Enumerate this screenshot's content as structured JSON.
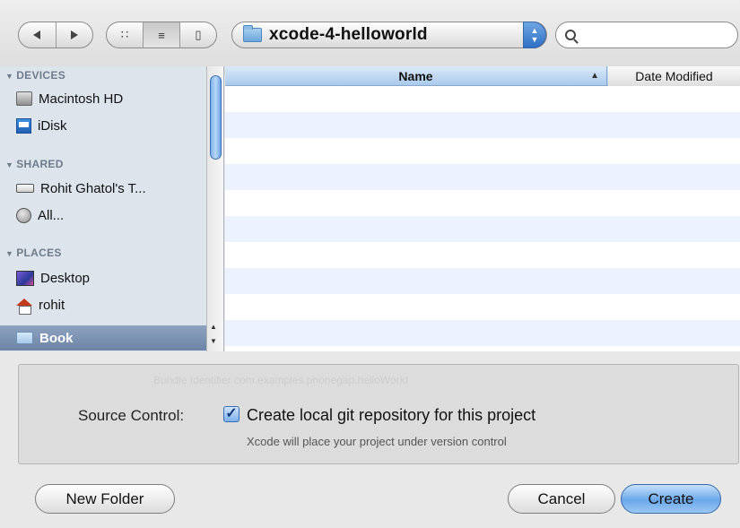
{
  "toolbar": {
    "nav": {
      "back_icon": "left-arrow-icon",
      "forward_icon": "right-arrow-icon"
    },
    "view_modes": [
      "icon-view-icon",
      "list-view-icon",
      "column-view-icon"
    ],
    "active_view": "list",
    "path_label": "xcode-4-helloworld",
    "search": {
      "value": "",
      "placeholder": ""
    }
  },
  "sidebar": {
    "devices_header": "DEVICES",
    "shared_header": "SHARED",
    "places_header": "PLACES",
    "devices": [
      {
        "label": "Macintosh HD",
        "icon": "hard-drive-icon"
      },
      {
        "label": "iDisk",
        "icon": "idisk-icon"
      }
    ],
    "shared": [
      {
        "label": "Rohit Ghatol's T...",
        "icon": "network-computer-icon"
      },
      {
        "label": "All...",
        "icon": "globe-icon"
      }
    ],
    "places": [
      {
        "label": "Desktop",
        "icon": "desktop-icon"
      },
      {
        "label": "rohit",
        "icon": "home-icon"
      },
      {
        "label": "Book",
        "icon": "folder-icon",
        "selected": true
      }
    ]
  },
  "filelist": {
    "col_name": "Name",
    "col_date": "Date Modified",
    "sort": "ascending"
  },
  "options": {
    "ghost_text": "Bundle Identifier  com.examples.phonegap.helloWorld",
    "source_control_label": "Source Control:",
    "checkbox_checked": true,
    "checkbox_label": "Create local git repository for this project",
    "checkbox_sublabel": "Xcode will place your project under version control"
  },
  "buttons": {
    "new_folder": "New Folder",
    "cancel": "Cancel",
    "create": "Create"
  },
  "colors": {
    "accent": "#6aa7ea",
    "selection": "#6c84a6",
    "row_alt": "#edf3fe"
  }
}
